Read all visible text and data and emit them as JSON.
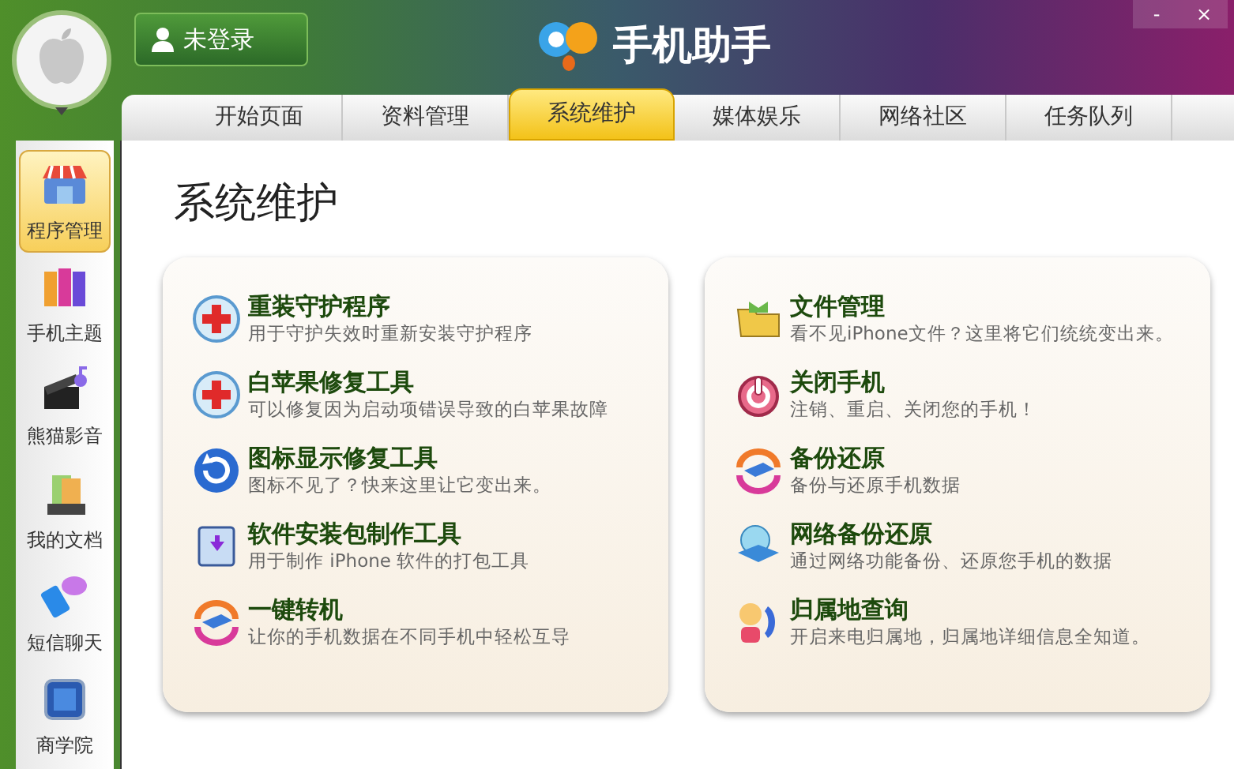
{
  "window": {
    "title": "手机助手",
    "controls": [
      "-",
      "×"
    ]
  },
  "login": {
    "label": "未登录"
  },
  "tabs": [
    {
      "label": "开始页面",
      "selected": false
    },
    {
      "label": "资料管理",
      "selected": false
    },
    {
      "label": "系统维护",
      "selected": true
    },
    {
      "label": "媒体娱乐",
      "selected": false
    },
    {
      "label": "网络社区",
      "selected": false
    },
    {
      "label": "任务队列",
      "selected": false
    }
  ],
  "sidebar": {
    "items": [
      {
        "label": "程序管理",
        "selected": true
      },
      {
        "label": "手机主题",
        "selected": false
      },
      {
        "label": "熊猫影音",
        "selected": false
      },
      {
        "label": "我的文档",
        "selected": false
      },
      {
        "label": "短信聊天",
        "selected": false
      },
      {
        "label": "商学院",
        "selected": false
      }
    ]
  },
  "page_title": "系统维护",
  "panels": [
    {
      "tools": [
        {
          "title": "重装守护程序",
          "description": "用于守护失效时重新安装守护程序"
        },
        {
          "title": "白苹果修复工具",
          "description": "可以修复因为启动项错误导致的白苹果故障"
        },
        {
          "title": "图标显示修复工具",
          "description": "图标不见了？快来这里让它变出来。"
        },
        {
          "title": "软件安装包制作工具",
          "description": "用于制作 iPhone 软件的打包工具"
        },
        {
          "title": "一键转机",
          "description": "让你的手机数据在不同手机中轻松互导"
        }
      ]
    },
    {
      "tools": [
        {
          "title": "文件管理",
          "description": "看不见iPhone文件？这里将它们统统变出来。"
        },
        {
          "title": "关闭手机",
          "description": "注销、重启、关闭您的手机！"
        },
        {
          "title": "备份还原",
          "description": "备份与还原手机数据"
        },
        {
          "title": "网络备份还原",
          "description": "通过网络功能备份、还原您手机的数据"
        },
        {
          "title": "归属地查询",
          "description": "开启来电归属地，归属地详细信息全知道。"
        }
      ]
    }
  ]
}
